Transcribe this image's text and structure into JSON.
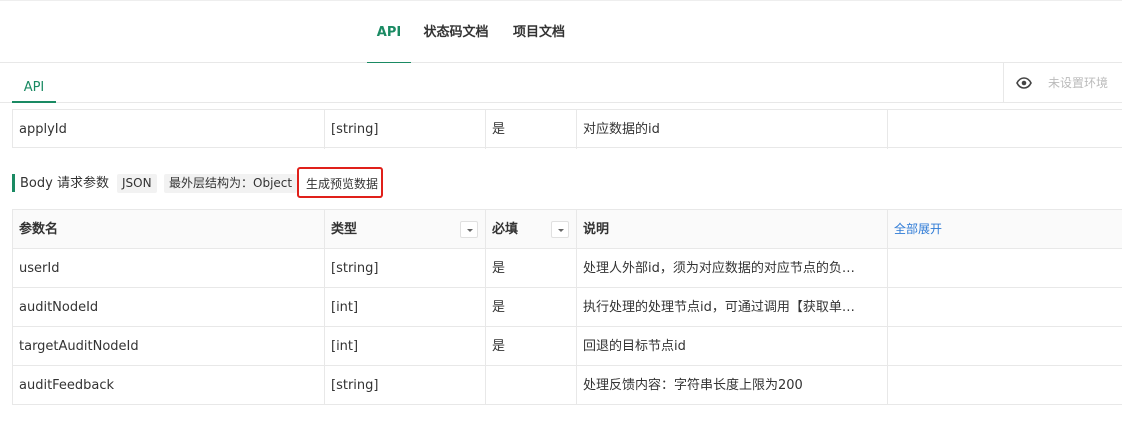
{
  "tabs": [
    {
      "label": "API",
      "active": true
    },
    {
      "label": "状态码文档",
      "active": false
    },
    {
      "label": "项目文档",
      "active": false
    }
  ],
  "subtab": {
    "label": "API"
  },
  "env": {
    "placeholder": "未设置环境",
    "icon": "eye-icon"
  },
  "query_table": {
    "rows": [
      {
        "name": "applyId",
        "type": "[string]",
        "required": "是",
        "desc": "对应数据的id"
      }
    ]
  },
  "body_section": {
    "title": "Body 请求参数",
    "format_tag": "JSON",
    "structure_tag": "最外层结构为：Object",
    "generate_button": "生成预览数据"
  },
  "body_table": {
    "headers": {
      "name": "参数名",
      "type": "类型",
      "required": "必填",
      "desc": "说明",
      "expand_all": "全部展开"
    },
    "rows": [
      {
        "name": "userId",
        "type": "[string]",
        "required": "是",
        "desc": "处理人外部id，须为对应数据的对应节点的负…"
      },
      {
        "name": "auditNodeId",
        "type": "[int]",
        "required": "是",
        "desc": "执行处理的处理节点id，可通过调用【获取单…"
      },
      {
        "name": "targetAuditNodeId",
        "type": "[int]",
        "required": "是",
        "desc": "回退的目标节点id"
      },
      {
        "name": "auditFeedback",
        "type": "[string]",
        "required": "",
        "desc": "处理反馈内容：字符串长度上限为200"
      }
    ]
  },
  "colors": {
    "accent": "#1a8a63",
    "link": "#2f7bd6",
    "highlight": "#e0201a"
  }
}
